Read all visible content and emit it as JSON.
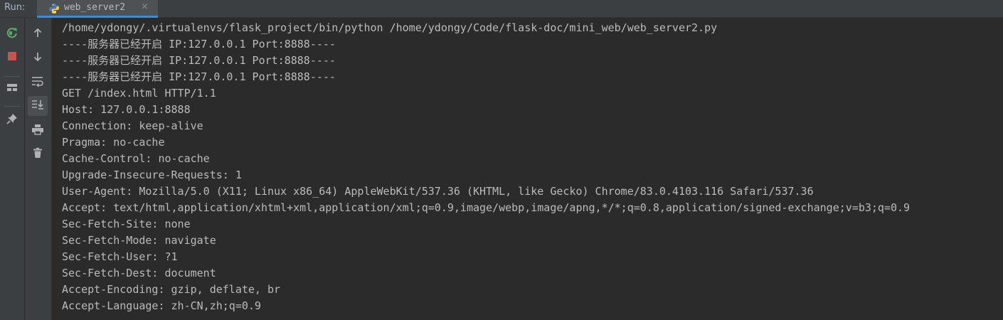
{
  "window": {
    "run_label": "Run:",
    "tab_label": "web_server2",
    "tab_close": "×"
  },
  "colors": {
    "background": "#2b2b2b",
    "toolbar": "#3c3f41",
    "text": "#bbbbbb",
    "rerun": "#59a869",
    "stop": "#c75450",
    "tab_accent": "#4a88c7"
  },
  "toolbar_left": [
    "rerun-icon",
    "stop-icon",
    "layout-icon",
    "pin-icon"
  ],
  "toolbar_right": [
    "up-arrow-icon",
    "down-arrow-icon",
    "soft-wrap-icon",
    "scroll-to-end-icon",
    "print-icon",
    "trash-icon"
  ],
  "console": {
    "lines": [
      "/home/ydongy/.virtualenvs/flask_project/bin/python /home/ydongy/Code/flask-doc/mini_web/web_server2.py",
      "----服务器已经开启 IP:127.0.0.1 Port:8888----",
      "----服务器已经开启 IP:127.0.0.1 Port:8888----",
      "----服务器已经开启 IP:127.0.0.1 Port:8888----",
      "GET /index.html HTTP/1.1",
      "Host: 127.0.0.1:8888",
      "Connection: keep-alive",
      "Pragma: no-cache",
      "Cache-Control: no-cache",
      "Upgrade-Insecure-Requests: 1",
      "User-Agent: Mozilla/5.0 (X11; Linux x86_64) AppleWebKit/537.36 (KHTML, like Gecko) Chrome/83.0.4103.116 Safari/537.36",
      "Accept: text/html,application/xhtml+xml,application/xml;q=0.9,image/webp,image/apng,*/*;q=0.8,application/signed-exchange;v=b3;q=0.9",
      "Sec-Fetch-Site: none",
      "Sec-Fetch-Mode: navigate",
      "Sec-Fetch-User: ?1",
      "Sec-Fetch-Dest: document",
      "Accept-Encoding: gzip, deflate, br",
      "Accept-Language: zh-CN,zh;q=0.9"
    ]
  }
}
